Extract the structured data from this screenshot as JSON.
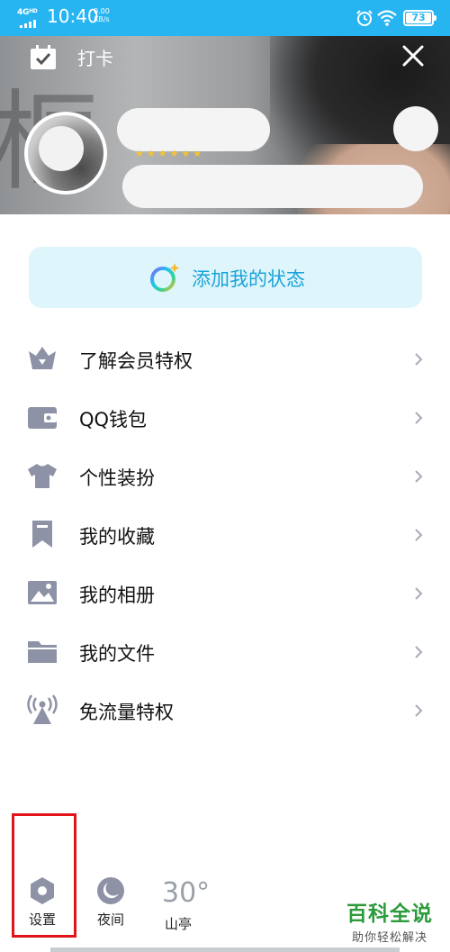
{
  "status_bar": {
    "network": "4G",
    "network_sub": "HD",
    "time": "10:40",
    "speed_value": "0.00",
    "speed_unit": "KB/s",
    "battery": "73",
    "icons": [
      "signal-icon",
      "alarm-icon",
      "wifi-icon",
      "battery-icon"
    ]
  },
  "header": {
    "checkin_label": "打卡"
  },
  "status_button": {
    "label": "添加我的状态"
  },
  "menu": {
    "items": [
      {
        "label": "了解会员特权",
        "icon": "vip-crown-icon"
      },
      {
        "label": "QQ钱包",
        "icon": "wallet-icon"
      },
      {
        "label": "个性装扮",
        "icon": "tshirt-icon"
      },
      {
        "label": "我的收藏",
        "icon": "bookmark-icon"
      },
      {
        "label": "我的相册",
        "icon": "photo-icon"
      },
      {
        "label": "我的文件",
        "icon": "folder-icon"
      },
      {
        "label": "免流量特权",
        "icon": "signal-tower-icon"
      }
    ]
  },
  "bottom": {
    "settings_label": "设置",
    "night_label": "夜间",
    "temperature": "30°",
    "location": "山亭"
  },
  "watermark": {
    "title": "百科全说",
    "subtitle": "助你轻松解决"
  },
  "colors": {
    "status_bar": "#27b5f2",
    "icon_gray": "#8e92a6",
    "accent_blue": "#1aa2d8",
    "highlight_red": "#e0141a"
  }
}
